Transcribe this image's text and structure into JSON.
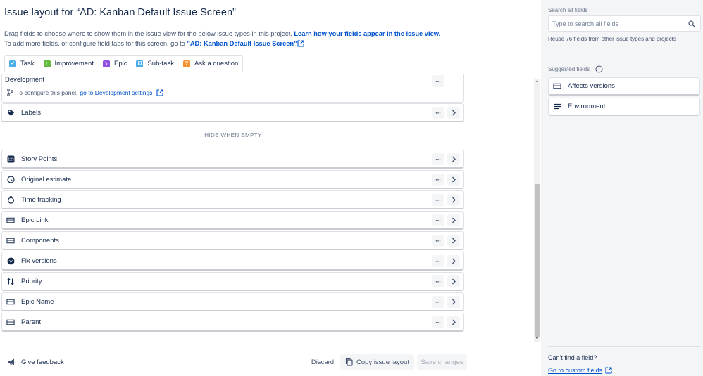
{
  "header": {
    "title": "Issue layout for “AD: Kanban Default Issue Screen”",
    "desc_line1": "Drag fields to choose where to show them in the issue view for the below issue types in this project.",
    "learn_link": "Learn how your fields appear in the issue view.",
    "desc_line2": "To add more fields, or configure field tabs for this screen, go to",
    "screen_link": "\"AD: Kanban Default Issue Screen\""
  },
  "issue_types": [
    {
      "label": "Task",
      "color": "#4bade8",
      "icon": "checkbox-icon"
    },
    {
      "label": "Improvement",
      "color": "#63ba3c",
      "icon": "arrow-up-icon"
    },
    {
      "label": "Epic",
      "color": "#904ee2",
      "icon": "lightning-icon"
    },
    {
      "label": "Sub-task",
      "color": "#4bade8",
      "icon": "subtask-icon"
    },
    {
      "label": "Ask a question",
      "color": "#f79232",
      "icon": "question-icon"
    }
  ],
  "development": {
    "label": "Development",
    "note": "To configure this panel,",
    "link": "go to Development settings"
  },
  "fields_top": [
    {
      "label": "Labels",
      "icon": "tag-icon"
    }
  ],
  "hide_when_empty_label": "HIDE WHEN EMPTY",
  "fields_hidden": [
    {
      "label": "Story Points",
      "icon": "number-icon"
    },
    {
      "label": "Original estimate",
      "icon": "clock-icon"
    },
    {
      "label": "Time tracking",
      "icon": "stopwatch-icon"
    },
    {
      "label": "Epic Link",
      "icon": "select-icon"
    },
    {
      "label": "Components",
      "icon": "select-icon"
    },
    {
      "label": "Fix versions",
      "icon": "chevron-circle-icon"
    },
    {
      "label": "Priority",
      "icon": "priority-icon"
    },
    {
      "label": "Epic Name",
      "icon": "select-icon"
    },
    {
      "label": "Parent",
      "icon": "select-icon"
    }
  ],
  "footer": {
    "feedback": "Give feedback",
    "discard": "Discard",
    "copy": "Copy issue layout",
    "save": "Save changes"
  },
  "sidebar": {
    "search_label": "Search all fields",
    "search_placeholder": "Type to search all fields",
    "reuse_text": "Reuse 76 fields from other issue types and projects",
    "suggested_label": "Suggested fields",
    "suggested": [
      {
        "label": "Affects versions",
        "icon": "select-icon"
      },
      {
        "label": "Environment",
        "icon": "paragraph-icon"
      }
    ],
    "cant_find": "Can't find a field?",
    "custom_link": "Go to custom fields"
  },
  "colors": {
    "link": "#0052cc",
    "text": "#172b4d",
    "panel_bg": "#f4f5f7"
  }
}
